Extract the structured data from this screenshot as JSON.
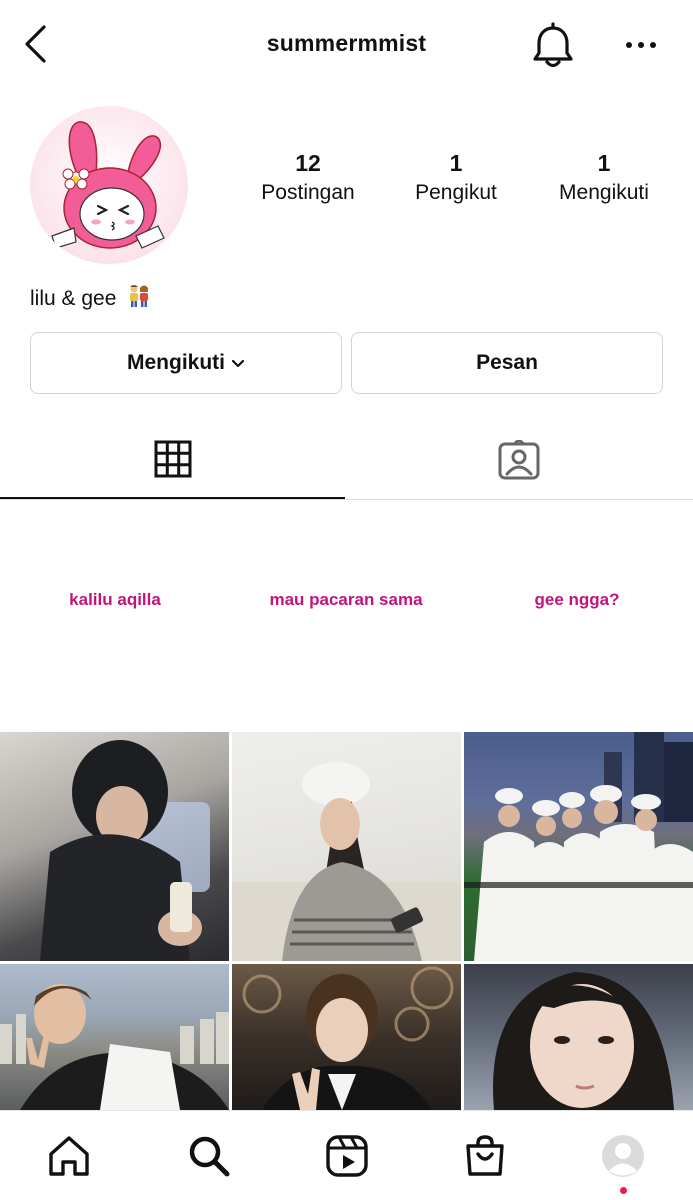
{
  "header": {
    "username": "summermmist",
    "icons": {
      "back": "chevron-left-icon",
      "notifications": "bell-icon",
      "more": "more-horizontal-icon"
    }
  },
  "profile": {
    "avatar": "avatar-illustration",
    "stats": [
      {
        "value": "12",
        "label": "Postingan"
      },
      {
        "value": "1",
        "label": "Pengikut"
      },
      {
        "value": "1",
        "label": "Mengikuti"
      }
    ],
    "bio": "lilu & gee",
    "bio_emoji": "couple-emoji"
  },
  "actions": {
    "following_label": "Mengikuti",
    "message_label": "Pesan"
  },
  "tabs": {
    "grid_icon": "grid-icon",
    "tagged_icon": "tagged-user-icon"
  },
  "highlights": [
    {
      "text": "kalilu aqilla"
    },
    {
      "text": "mau pacaran sama"
    },
    {
      "text": "gee ngga?"
    }
  ],
  "colors": {
    "highlight_text": "#c3137c",
    "notification_dot": "#ed1b48",
    "border": "#d4d4d4"
  },
  "bottom_nav": {
    "items": [
      "home-icon",
      "search-icon",
      "reels-icon",
      "shop-icon",
      "profile-icon"
    ]
  }
}
